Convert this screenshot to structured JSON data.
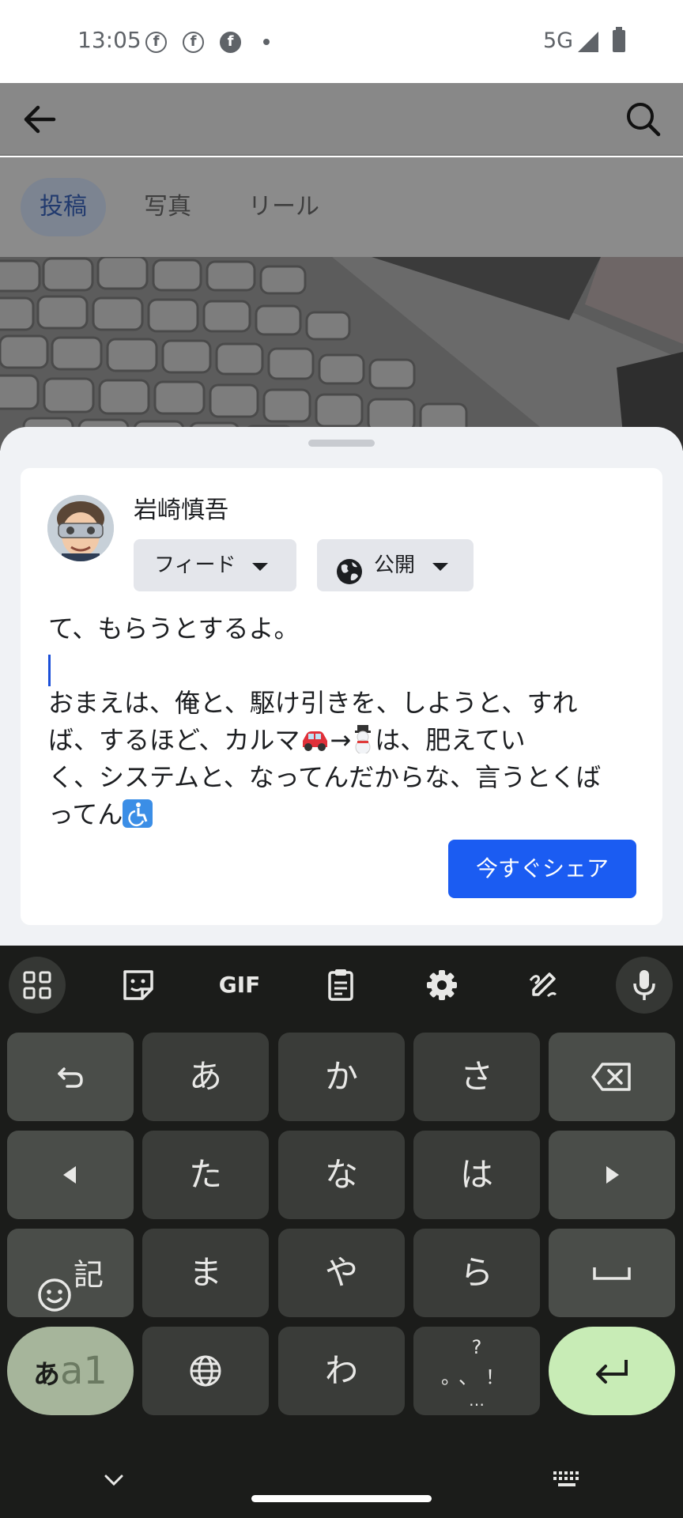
{
  "status_bar": {
    "time": "13:05",
    "notification_icons": [
      "facebook-icon",
      "facebook-icon",
      "facebook-icon"
    ],
    "network": "5G"
  },
  "app": {
    "tabs": [
      "投稿",
      "写真",
      "リール"
    ],
    "active_tab": "投稿"
  },
  "composer": {
    "username": "岩崎慎吾",
    "audience_feed": "フィード",
    "audience_privacy": "公開",
    "text_line1": "て、もらうとするよ。",
    "text_line3a": "おまえは、俺と、駆け引きを、しようと、すれ",
    "text_line4a": "ば、するほど、カルマ",
    "text_line4b": "→",
    "text_line4c": "は、肥えてい",
    "text_line5": "く、システムと、なってんだからな、言うとくば",
    "text_line6": "ってん",
    "emojis": [
      "car-emoji",
      "snowman-emoji",
      "wheelchair-emoji"
    ],
    "share_button": "今すぐシェア"
  },
  "keyboard": {
    "toolbar": [
      "apps-icon",
      "sticker-icon",
      "GIF",
      "clipboard-icon",
      "settings-icon",
      "handwriting-icon",
      "mic-icon"
    ],
    "gif_label": "GIF",
    "row1": [
      "あ",
      "か",
      "さ"
    ],
    "row2": [
      "た",
      "な",
      "は"
    ],
    "row3_left": "記",
    "row3": [
      "ま",
      "や",
      "ら"
    ],
    "row4_mode_a": "あ",
    "row4_mode_b": "a1",
    "row4_wa": "わ",
    "punct_q": "?",
    "punct_marks": "。、！",
    "punct_ellipsis": "…"
  },
  "colors": {
    "accent": "#1b5cf2",
    "keyboard_bg": "#1b1c1a",
    "enter_key": "#c8ecb6"
  }
}
